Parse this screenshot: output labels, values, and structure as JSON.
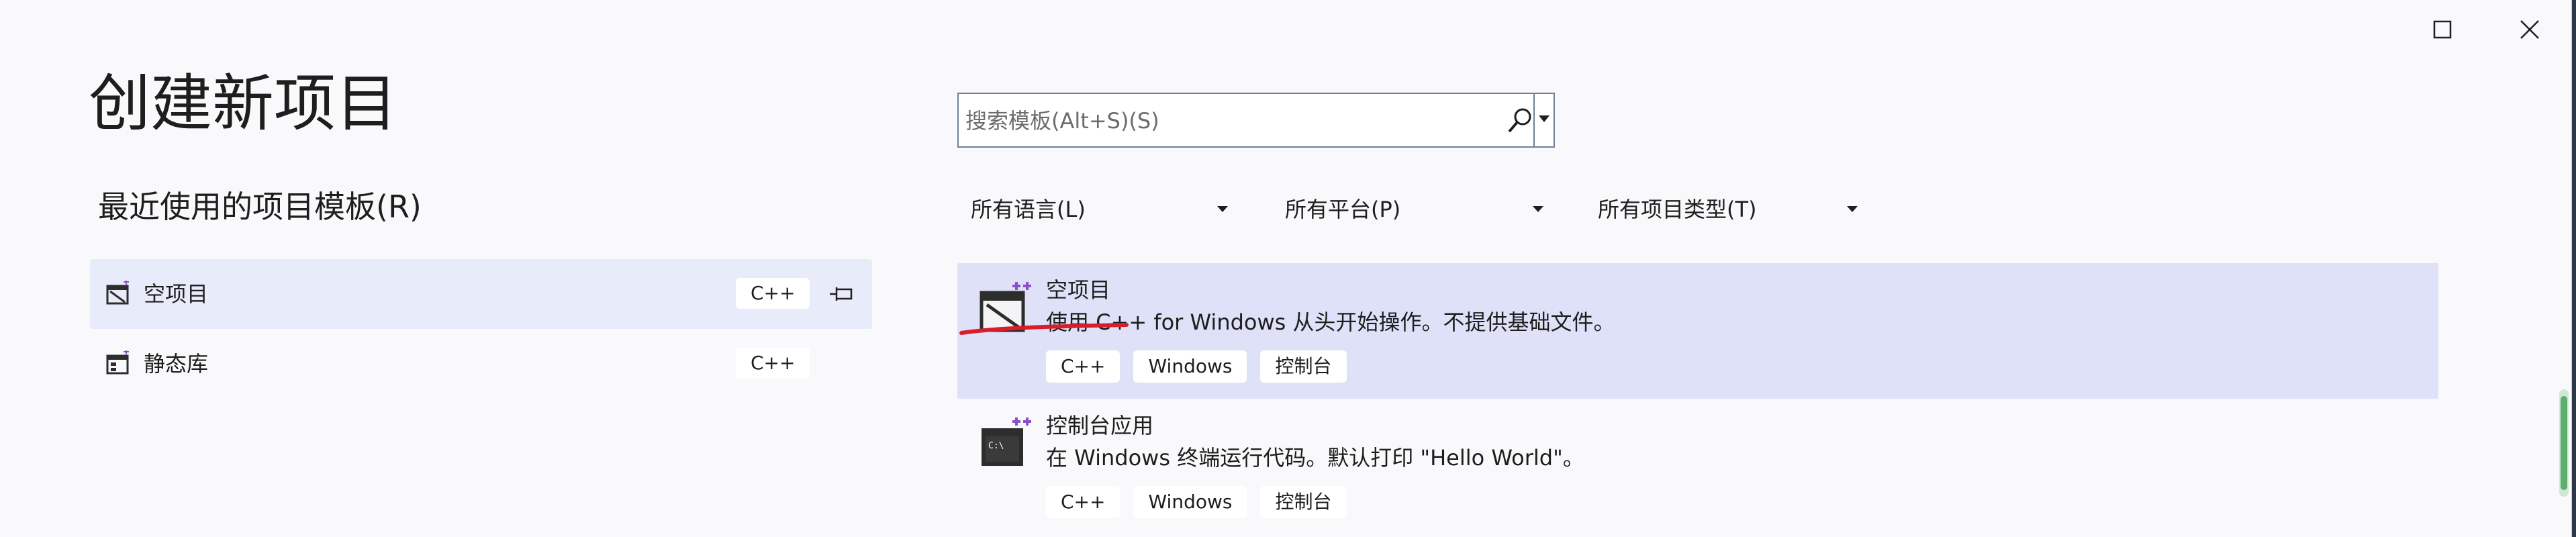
{
  "window": {
    "title": "创建新项目"
  },
  "recent": {
    "heading": "最近使用的项目模板(R)",
    "items": [
      {
        "name": "空项目",
        "lang": "C++",
        "pinned": true,
        "icon": "empty-project-icon"
      },
      {
        "name": "静态库",
        "lang": "C++",
        "pinned": false,
        "icon": "static-library-icon"
      }
    ]
  },
  "search": {
    "placeholder": "搜索模板(Alt+S)(S)",
    "icon": "search-icon"
  },
  "filters": [
    {
      "label": "所有语言(L)"
    },
    {
      "label": "所有平台(P)"
    },
    {
      "label": "所有项目类型(T)"
    }
  ],
  "templates": [
    {
      "name": "空项目",
      "description": "使用 C++ for Windows 从头开始操作。不提供基础文件。",
      "tags": [
        "C++",
        "Windows",
        "控制台"
      ],
      "icon": "empty-project-icon"
    },
    {
      "name": "控制台应用",
      "description": "在 Windows 终端运行代码。默认打印 \"Hello World\"。",
      "tags": [
        "C++",
        "Windows",
        "控制台"
      ],
      "icon": "console-app-icon"
    }
  ],
  "colors": {
    "accent": "#8a4fc9",
    "selected": "#dee1f8",
    "annotation": "#d81e2a"
  }
}
